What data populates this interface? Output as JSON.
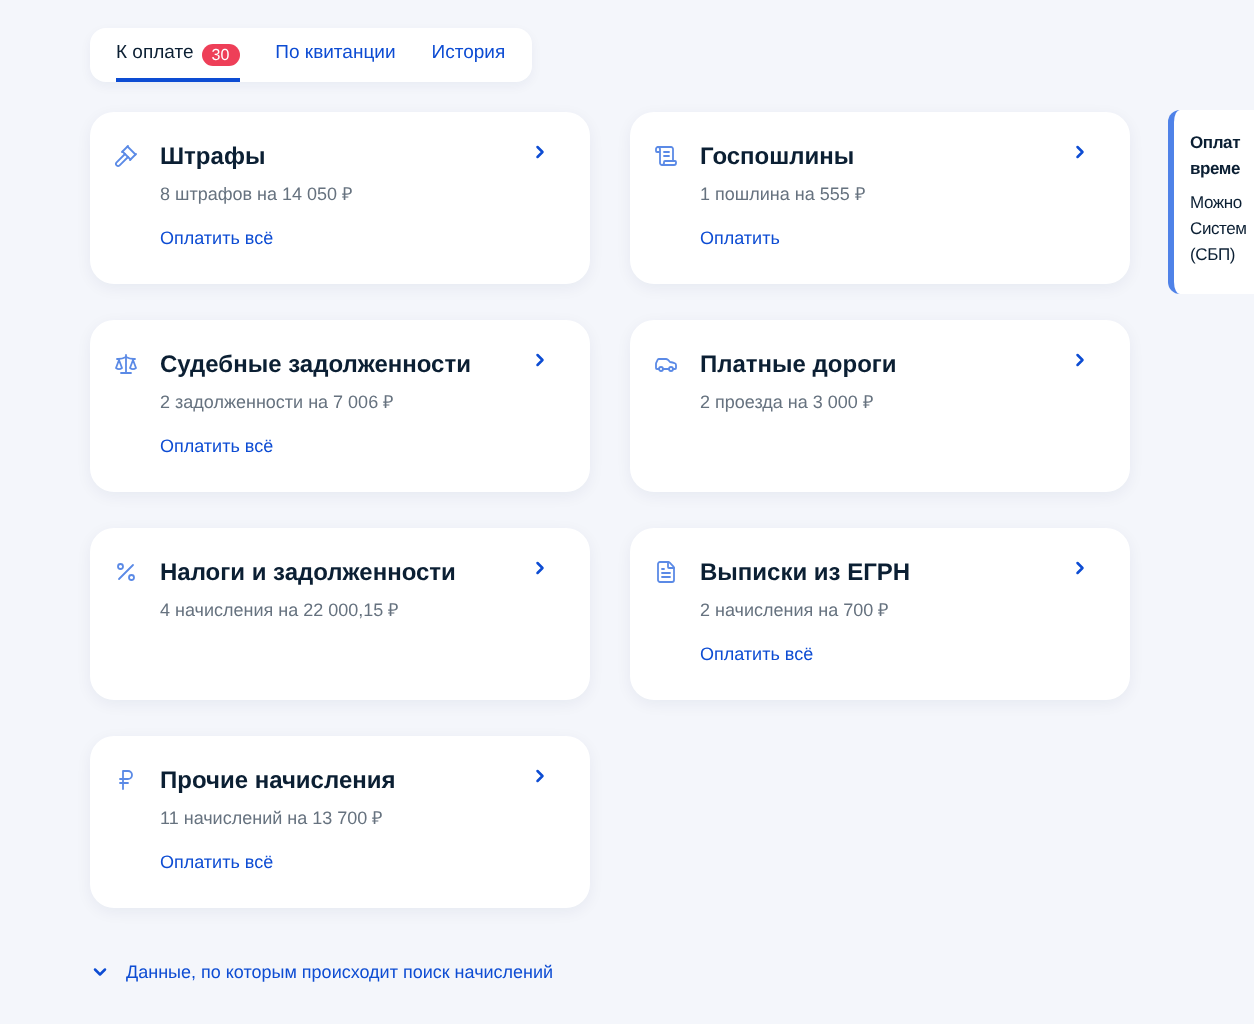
{
  "tabs": [
    {
      "label": "К оплате",
      "badge": "30",
      "selected": true
    },
    {
      "label": "По квитанции",
      "selected": false
    },
    {
      "label": "История",
      "selected": false
    }
  ],
  "cards": [
    {
      "title": "Штрафы",
      "subtitle": "8 штрафов на 14 050 ₽",
      "link": "Оплатить всё"
    },
    {
      "title": "Госпошлины",
      "subtitle": "1 пошлина на 555 ₽",
      "link": "Оплатить"
    },
    {
      "title": "Судебные задолженности",
      "subtitle": "2 задолженности на 7 006 ₽",
      "link": "Оплатить всё"
    },
    {
      "title": "Платные дороги",
      "subtitle": "2 проезда на 3 000 ₽"
    },
    {
      "title": "Налоги и задолженности",
      "subtitle": "4 начисления на 22 000,15 ₽"
    },
    {
      "title": "Выписки из ЕГРН",
      "subtitle": "2 начисления на 700 ₽",
      "link": "Оплатить всё"
    },
    {
      "title": "Прочие начисления",
      "subtitle": "11 начислений на 13 700 ₽",
      "link": "Оплатить всё"
    }
  ],
  "search_data_link": {
    "label": "Данные, по которым происходит поиск начислений",
    "expanded": false
  },
  "info_panel": {
    "title_lines": [
      "Оплат",
      "време"
    ],
    "text_lines": [
      "Можно",
      "Систем",
      "(СБП)"
    ]
  }
}
